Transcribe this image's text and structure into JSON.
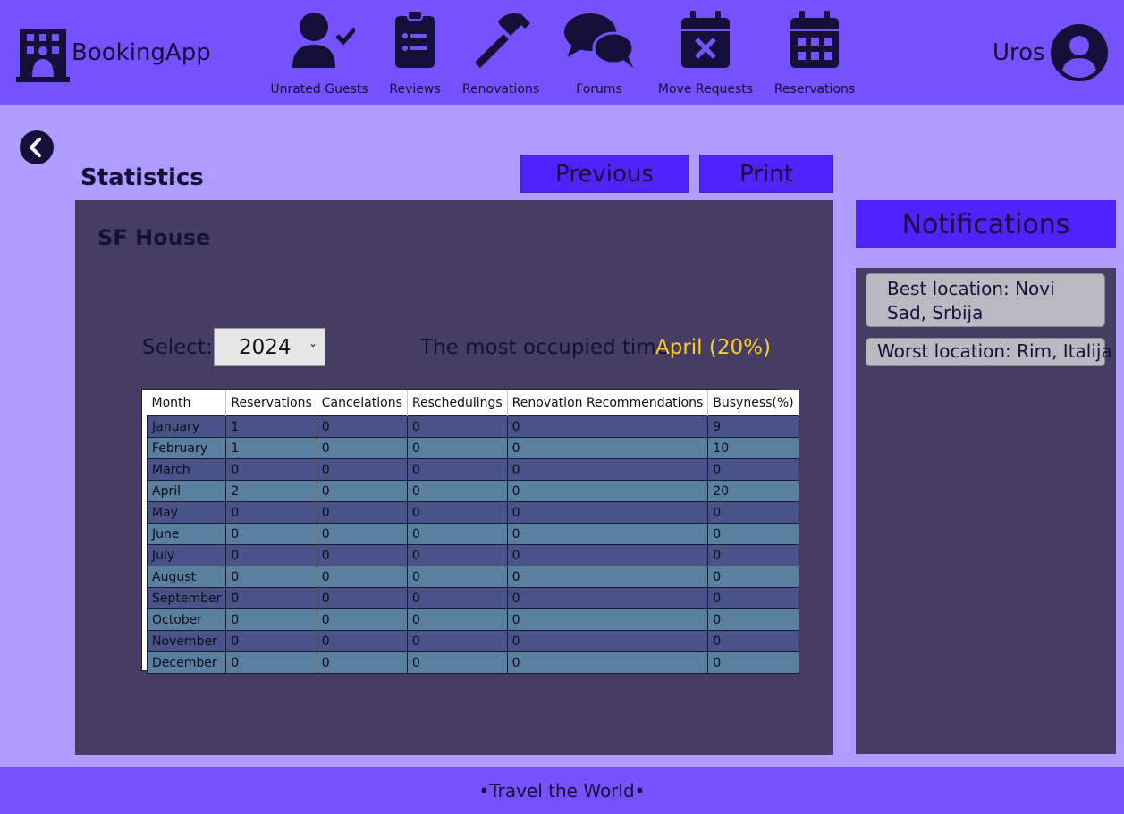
{
  "app": {
    "name": "BookingApp"
  },
  "nav": [
    {
      "label": "Unrated Guests",
      "icon": "user-check-icon"
    },
    {
      "label": "Reviews",
      "icon": "clipboard-list-icon"
    },
    {
      "label": "Renovations",
      "icon": "hammer-icon"
    },
    {
      "label": "Forums",
      "icon": "chat-bubbles-icon"
    },
    {
      "label": "Move Requests",
      "icon": "calendar-x-icon"
    },
    {
      "label": "Reservations",
      "icon": "calendar-grid-icon"
    }
  ],
  "user": {
    "name": "Uros"
  },
  "page": {
    "title": "Statistics",
    "previous_label": "Previous",
    "print_label": "Print",
    "property_name": "SF House",
    "select_label": "Select:",
    "selected_year": "2024",
    "most_occupied_label": "The most occupied time:",
    "most_occupied_value": "April (20%)"
  },
  "table": {
    "columns": [
      "Month",
      "Reservations",
      "Cancelations",
      "Reschedulings",
      "Renovation Recommendations",
      "Busyness(%)"
    ],
    "rows": [
      [
        "January",
        "1",
        "0",
        "0",
        "0",
        "9"
      ],
      [
        "February",
        "1",
        "0",
        "0",
        "0",
        "10"
      ],
      [
        "March",
        "0",
        "0",
        "0",
        "0",
        "0"
      ],
      [
        "April",
        "2",
        "0",
        "0",
        "0",
        "20"
      ],
      [
        "May",
        "0",
        "0",
        "0",
        "0",
        "0"
      ],
      [
        "June",
        "0",
        "0",
        "0",
        "0",
        "0"
      ],
      [
        "July",
        "0",
        "0",
        "0",
        "0",
        "0"
      ],
      [
        "August",
        "0",
        "0",
        "0",
        "0",
        "0"
      ],
      [
        "September",
        "0",
        "0",
        "0",
        "0",
        "0"
      ],
      [
        "October",
        "0",
        "0",
        "0",
        "0",
        "0"
      ],
      [
        "November",
        "0",
        "0",
        "0",
        "0",
        "0"
      ],
      [
        "December",
        "0",
        "0",
        "0",
        "0",
        "0"
      ]
    ]
  },
  "notifications": {
    "title": "Notifications",
    "items": [
      "Best location: Novi Sad, Srbija",
      "Worst location: Rim, Italija"
    ]
  },
  "footer": {
    "text": "•Travel the World•"
  },
  "colors": {
    "header": "#7552fc",
    "background": "#ae9cff",
    "panel": "#453d63",
    "button": "#5222fd",
    "highlight": "#ffcf24"
  }
}
